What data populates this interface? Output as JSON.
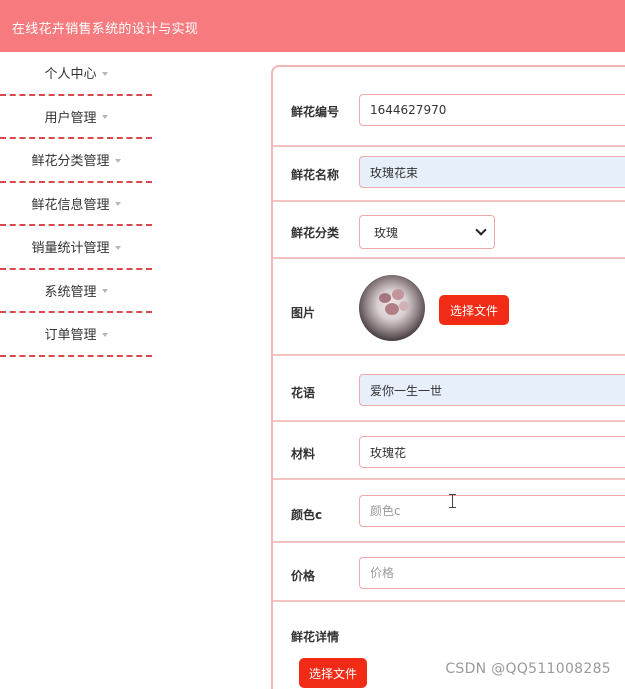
{
  "header": {
    "title": "在线花卉销售系统的设计与实现"
  },
  "sidebar": {
    "items": [
      {
        "label": "个人中心"
      },
      {
        "label": "用户管理"
      },
      {
        "label": "鲜花分类管理"
      },
      {
        "label": "鲜花信息管理"
      },
      {
        "label": "销量统计管理"
      },
      {
        "label": "系统管理"
      },
      {
        "label": "订单管理"
      }
    ]
  },
  "form": {
    "flower_id": {
      "label": "鲜花编号",
      "value": "1644627970"
    },
    "flower_name": {
      "label": "鲜花名称",
      "value": "玫瑰花束"
    },
    "flower_category": {
      "label": "鲜花分类",
      "value": "玫瑰"
    },
    "image": {
      "label": "图片",
      "button": "选择文件"
    },
    "flower_language": {
      "label": "花语",
      "value": "爱你一生一世"
    },
    "material": {
      "label": "材料",
      "value": "玫瑰花"
    },
    "color": {
      "label": "颜色c",
      "placeholder": "颜色c"
    },
    "price": {
      "label": "价格",
      "placeholder": "价格"
    },
    "details": {
      "label": "鲜花详情",
      "button": "选择文件"
    }
  },
  "watermark": "CSDN @QQ511008285",
  "colors": {
    "header_bg": "#f77b7e",
    "accent_red": "#f22b16",
    "border_pink": "#eea9ab",
    "input_blue": "#e7effb"
  }
}
